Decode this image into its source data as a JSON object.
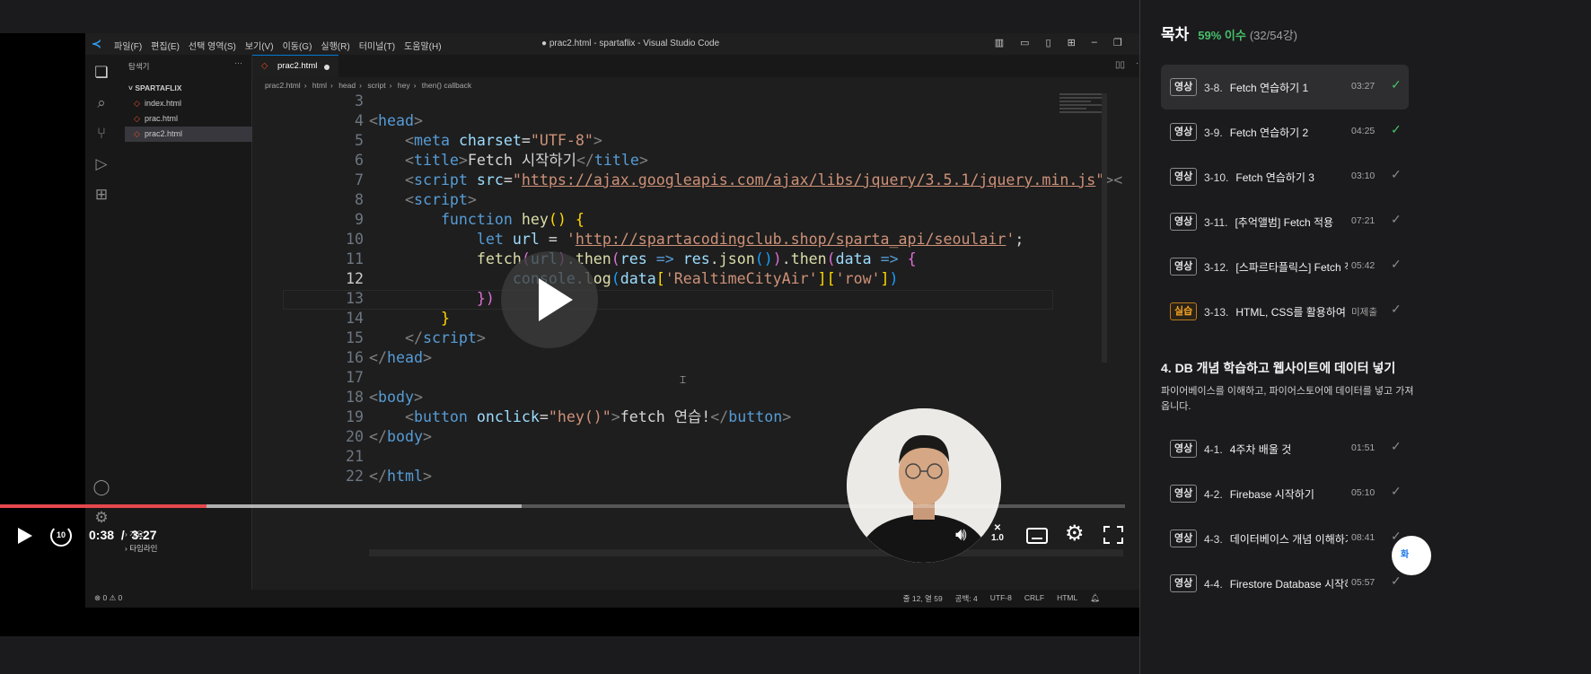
{
  "vscode": {
    "menu": [
      "파일(F)",
      "편집(E)",
      "선택 영역(S)",
      "보기(V)",
      "이동(G)",
      "실행(R)",
      "터미널(T)",
      "도움말(H)"
    ],
    "window_title": "● prac2.html - spartaflix - Visual Studio Code",
    "explorer_label": "탐색기",
    "project_name": "SPARTAFLIX",
    "files": [
      "index.html",
      "prac.html",
      "prac2.html"
    ],
    "outline_label": "개요",
    "timeline_label": "타임라인",
    "tab_label": "prac2.html",
    "breadcrumbs": [
      "prac2.html",
      "html",
      "head",
      "script",
      "hey",
      "then() callback"
    ],
    "status_left": "⊗ 0 ⚠ 0",
    "status_right": [
      "줄 12, 열 59",
      "공백: 4",
      "UTF-8",
      "CRLF",
      "HTML"
    ],
    "line_numbers": [
      "3",
      "4",
      "5",
      "6",
      "7",
      "8",
      "9",
      "10",
      "11",
      "12",
      "13",
      "14",
      "15",
      "16",
      "17",
      "18",
      "19",
      "20",
      "21",
      "22"
    ]
  },
  "player": {
    "current_time": "0:38",
    "separator": "/",
    "duration": "3:27",
    "progress_fraction": 0.1836,
    "buffer_fraction": 0.464,
    "rewind_label": "10",
    "speed_label": "1.0",
    "speed_icon": "✕"
  },
  "toc": {
    "title": "목차",
    "progress_pct": "59% 이수",
    "progress_count": "(32/54강)",
    "lessons_a": [
      {
        "badge": "영상",
        "num": "3-8.",
        "title": "Fetch 연습하기 1",
        "dur": "03:27",
        "check": "✓",
        "done": true,
        "active": true
      },
      {
        "badge": "영상",
        "num": "3-9.",
        "title": "Fetch 연습하기 2",
        "dur": "04:25",
        "check": "✓",
        "done": true
      },
      {
        "badge": "영상",
        "num": "3-10.",
        "title": "Fetch 연습하기 3",
        "dur": "03:10",
        "check": "✓",
        "done": false
      },
      {
        "badge": "영상",
        "num": "3-11.",
        "title": "[추억앨범] Fetch 적용",
        "dur": "07:21",
        "check": "✓",
        "done": false
      },
      {
        "badge": "영상",
        "num": "3-12.",
        "title": "[스파르타플릭스] Fetch 적",
        "dur": "05:42",
        "check": "✓",
        "done": false
      },
      {
        "badge": "실습",
        "num": "3-13.",
        "title": "HTML, CSS를 활용하여 화",
        "dur": "미제출",
        "check": "✓",
        "done": false,
        "practice": true
      }
    ],
    "section_title": "4. DB 개념 학습하고 웹사이트에 데이터 넣기",
    "section_desc": "파이어베이스를 이해하고, 파이어스토어에 데이터를 넣고 가져 옵니다.",
    "lessons_b": [
      {
        "badge": "영상",
        "num": "4-1.",
        "title": "4주차 배울 것",
        "dur": "01:51",
        "check": "✓"
      },
      {
        "badge": "영상",
        "num": "4-2.",
        "title": "Firebase 시작하기",
        "dur": "05:10",
        "check": "✓"
      },
      {
        "badge": "영상",
        "num": "4-3.",
        "title": "데이터베이스 개념 이해하기",
        "dur": "08:41",
        "check": "✓"
      },
      {
        "badge": "영상",
        "num": "4-4.",
        "title": "Firestore Database 시작하",
        "dur": "05:57",
        "check": "✓"
      }
    ],
    "fab_label": "화"
  },
  "colors": {
    "accent_green": "#46c06a",
    "progress_red": "#e5484d",
    "practice_orange": "#f6a623"
  }
}
